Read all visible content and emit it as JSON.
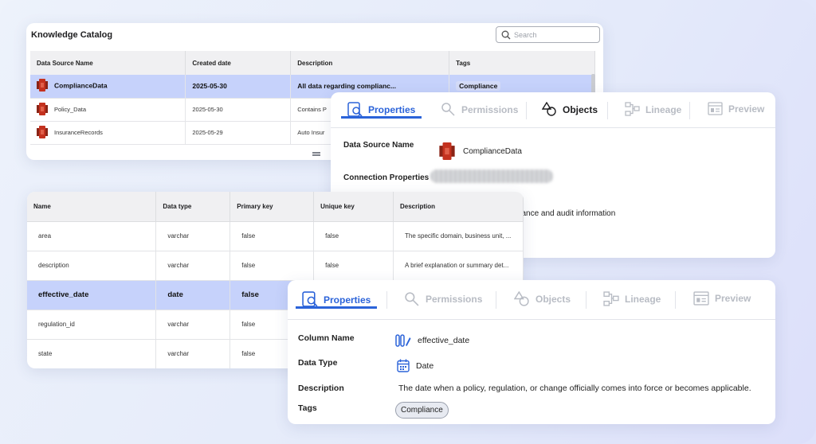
{
  "catalog": {
    "title": "Knowledge Catalog",
    "search_placeholder": "Search",
    "columns": [
      "Data Source Name",
      "Created date",
      "Description",
      "Tags"
    ],
    "rows": [
      {
        "name": "ComplianceData",
        "date": "2025-05-30",
        "desc": "All data regarding complianc...",
        "tag": "Compliance"
      },
      {
        "name": "Policy_Data",
        "date": "2025-05-30",
        "desc": "Contains P",
        "tag": ""
      },
      {
        "name": "InsuranceRecords",
        "date": "2025-05-29",
        "desc": "Auto Insur",
        "tag": ""
      }
    ]
  },
  "tabs": [
    "Properties",
    "Permissions",
    "Objects",
    "Lineage",
    "Preview"
  ],
  "ds_properties": {
    "source_label": "Data Source Name",
    "source_value": "ComplianceData",
    "connection_label": "Connection Properties",
    "desc_fragment": "liance and audit information"
  },
  "columns_table": {
    "headers": [
      "Name",
      "Data type",
      "Primary key",
      "Unique key",
      "Description"
    ],
    "rows": [
      {
        "name": "area",
        "type": "varchar",
        "pk": "false",
        "uk": "false",
        "desc": "The specific domain, business unit, ..."
      },
      {
        "name": "description",
        "type": "varchar",
        "pk": "false",
        "uk": "false",
        "desc": "A brief explanation or summary det..."
      },
      {
        "name": "effective_date",
        "type": "date",
        "pk": "false",
        "uk": "",
        "desc": ""
      },
      {
        "name": "regulation_id",
        "type": "varchar",
        "pk": "false",
        "uk": "",
        "desc": ""
      },
      {
        "name": "state",
        "type": "varchar",
        "pk": "false",
        "uk": "",
        "desc": ""
      }
    ]
  },
  "col_properties": {
    "column_name_label": "Column Name",
    "column_name_value": "effective_date",
    "data_type_label": "Data Type",
    "data_type_value": "Date",
    "description_label": "Description",
    "description_value": "The date when a policy, regulation, or change officially comes into force or becomes applicable.",
    "tags_label": "Tags",
    "tag_value": "Compliance"
  },
  "colors": {
    "accent": "#2b63d9",
    "selected_row": "#c6d2fb",
    "source_icon": "#c4321f"
  }
}
